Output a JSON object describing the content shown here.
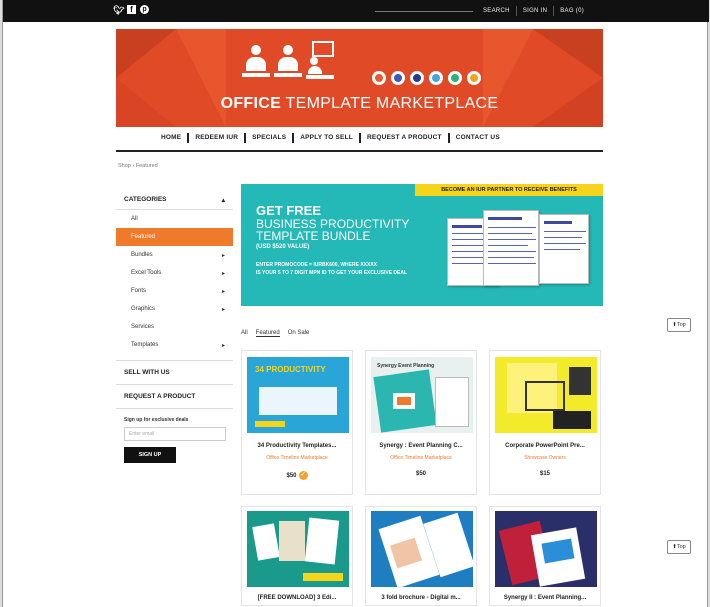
{
  "topbar": {
    "social": [
      "twitter-icon",
      "facebook-icon",
      "pinterest-icon"
    ],
    "links": [
      "SEARCH",
      "SIGN IN",
      "BAG (0)"
    ]
  },
  "banner": {
    "title_bold": "OFFICE",
    "title_rest": " TEMPLATE MARKETPLACE",
    "colors": {
      "background": "#e04a26"
    }
  },
  "nav": {
    "items": [
      "HOME",
      "REDEEM IUR",
      "SPECIALS",
      "APPLY TO SELL",
      "REQUEST A PRODUCT",
      "CONTACT US"
    ]
  },
  "breadcrumb": "Shop › Featured",
  "sidebar": {
    "categories_label": "CATEGORIES",
    "categories": [
      {
        "label": "All",
        "arrow": ""
      },
      {
        "label": "Featured",
        "arrow": "",
        "active": true
      },
      {
        "label": "Bundles",
        "arrow": "▸"
      },
      {
        "label": "Excel Tools",
        "arrow": "▸"
      },
      {
        "label": "Fonts",
        "arrow": "▸"
      },
      {
        "label": "Graphics",
        "arrow": "▸"
      },
      {
        "label": "Services",
        "arrow": ""
      },
      {
        "label": "Templates",
        "arrow": "▸"
      }
    ],
    "sell_label": "SELL WITH US",
    "request_label": "REQUEST A PRODUCT",
    "newsletter_note": "Sign up for exclusive deals",
    "email_placeholder": "Enter email",
    "signup_label": "SIGN UP"
  },
  "promo": {
    "ribbon": "BECOME AN IUR PARTNER TO RECEIVE BENEFITS",
    "line1": "GET FREE",
    "line2": "BUSINESS PRODUCTIVITY",
    "line3": "TEMPLATE BUNDLE",
    "value": "(USD $520 VALUE)",
    "note1": "ENTER PROMOCODE = IURBK600, WHERE XXXXX",
    "note2": "IS YOUR 5 TO 7 DIGIT MPN ID TO GET YOUR EXCLUSIVE DEAL",
    "colors": {
      "background": "#24b8b6",
      "ribbon": "#f5d41a"
    }
  },
  "filters": [
    "All",
    "Featured",
    "On Sale"
  ],
  "products": [
    {
      "title": "34 Productivity Templates...",
      "vendor": "Office Timeline Marketplace",
      "price": "$50",
      "image_text": "34 PRODUCTIVITY",
      "badge": "✓"
    },
    {
      "title": "Synergy : Event Planning C...",
      "vendor": "Office Timeline Marketplace",
      "price": "$50",
      "image_text": "Synergy Event Planning"
    },
    {
      "title": "Corporate PowerPoint Pre...",
      "vendor": "Showcase Owners",
      "price": "$15",
      "image_text": ""
    }
  ],
  "products_row2": [
    {
      "title": "[FREE DOWNLOAD] 3 Edi..."
    },
    {
      "title": "3 fold brochure - Digital m..."
    },
    {
      "title": "Synergy II : Event Planning..."
    }
  ],
  "top_button": "⬆Top"
}
